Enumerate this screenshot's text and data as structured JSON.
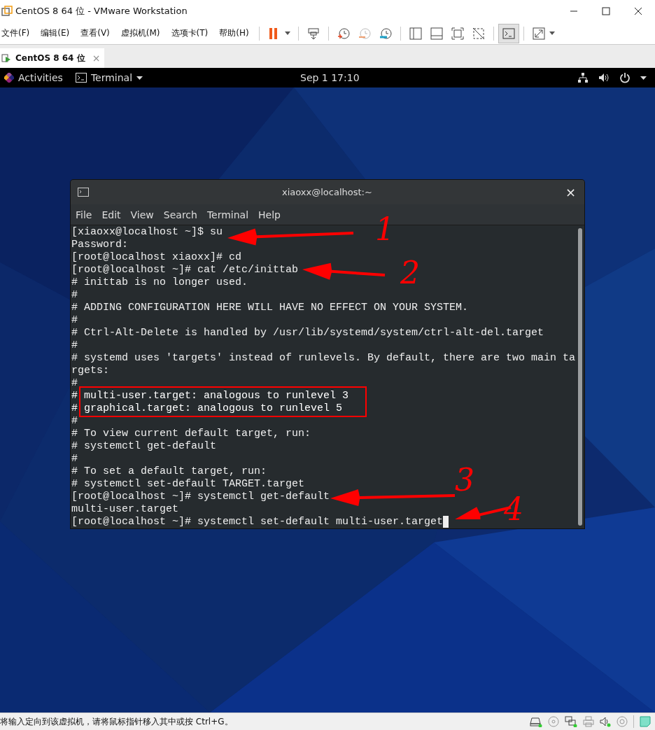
{
  "window": {
    "title": "CentOS 8 64 位 - VMware Workstation"
  },
  "menu": [
    "文件(F)",
    "编辑(E)",
    "查看(V)",
    "虚拟机(M)",
    "选项卡(T)",
    "帮助(H)"
  ],
  "toolbar": [
    {
      "kind": "pause",
      "selected": false
    },
    {
      "kind": "send-keys",
      "selected": false
    },
    {
      "kind": "snapshot",
      "selected": false
    },
    {
      "kind": "revert",
      "selected": false
    },
    {
      "kind": "manage",
      "selected": false
    },
    {
      "kind": "library",
      "selected": false
    },
    {
      "kind": "thumbnail",
      "selected": false
    },
    {
      "kind": "fullscreen",
      "selected": false
    },
    {
      "kind": "unity",
      "selected": false
    },
    {
      "kind": "console",
      "selected": true
    },
    {
      "kind": "stretch",
      "selected": false
    }
  ],
  "tabs": [
    {
      "label": "CentOS 8 64 位",
      "close": "×",
      "selected": true
    }
  ],
  "gnome_bar": {
    "activities": "Activities",
    "app_menu": "Terminal",
    "clock": "Sep 1  17:10"
  },
  "terminal": {
    "title": "xiaoxx@localhost:~",
    "close": "×",
    "menu": [
      "File",
      "Edit",
      "View",
      "Search",
      "Terminal",
      "Help"
    ],
    "lines": [
      {
        "text": "[xiaoxx@localhost ~]$ su",
        "boxed": false
      },
      {
        "text": "Password:",
        "boxed": false
      },
      {
        "text": "[root@localhost xiaoxx]# cd",
        "boxed": false
      },
      {
        "text": "[root@localhost ~]# cat /etc/inittab",
        "boxed": false
      },
      {
        "text": "# inittab is no longer used.",
        "boxed": false
      },
      {
        "text": "#",
        "boxed": false
      },
      {
        "text": "# ADDING CONFIGURATION HERE WILL HAVE NO EFFECT ON YOUR SYSTEM.",
        "boxed": false
      },
      {
        "text": "#",
        "boxed": false
      },
      {
        "text": "# Ctrl-Alt-Delete is handled by /usr/lib/systemd/system/ctrl-alt-del.target",
        "boxed": false
      },
      {
        "text": "#",
        "boxed": false
      },
      {
        "text": "# systemd uses 'targets' instead of runlevels. By default, there are two main ta",
        "boxed": false
      },
      {
        "text": "rgets:",
        "boxed": false
      },
      {
        "text": "#",
        "boxed": false
      },
      {
        "text": "# multi-user.target: analogous to runlevel 3",
        "boxed": true
      },
      {
        "text": "# graphical.target: analogous to runlevel 5",
        "boxed": true
      },
      {
        "text": "#",
        "boxed": false
      },
      {
        "text": "# To view current default target, run:",
        "boxed": false
      },
      {
        "text": "# systemctl get-default",
        "boxed": false
      },
      {
        "text": "#",
        "boxed": false
      },
      {
        "text": "# To set a default target, run:",
        "boxed": false
      },
      {
        "text": "# systemctl set-default TARGET.target",
        "boxed": false
      },
      {
        "text": "[root@localhost ~]# systemctl get-default",
        "boxed": false
      },
      {
        "text": "multi-user.target",
        "boxed": false
      },
      {
        "text": "[root@localhost ~]# systemctl set-default multi-user.target",
        "boxed": false
      }
    ],
    "annotations": [
      {
        "label": "1"
      },
      {
        "label": "2"
      },
      {
        "label": "3"
      },
      {
        "label": "4"
      }
    ]
  },
  "status_bar": {
    "message": "将输入定向到该虚拟机，请将鼠标指针移入其中或按 Ctrl+G。"
  }
}
